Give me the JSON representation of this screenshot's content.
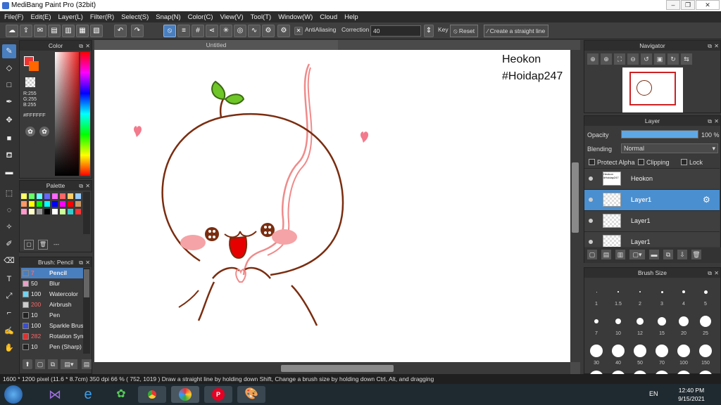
{
  "window": {
    "title": "MediBang Paint Pro (32bit)"
  },
  "menu": [
    "File(F)",
    "Edit(E)",
    "Layer(L)",
    "Filter(R)",
    "Select(S)",
    "Snap(N)",
    "Color(C)",
    "View(V)",
    "Tool(T)",
    "Window(W)",
    "Cloud",
    "Help"
  ],
  "toolbar": {
    "antialias_label": "AntiAliasing",
    "correction_label": "Correction",
    "correction_value": "40",
    "key_label": "Key",
    "reset_label": "Reset",
    "straight_label": "Create a straight line"
  },
  "color_panel": {
    "title": "Color",
    "r": "R:255",
    "g": "G:255",
    "b": "B:255",
    "hex": "#FFFFFF"
  },
  "palette_panel": {
    "title": "Palette",
    "extra": "---"
  },
  "brush_panel": {
    "title": "Brush: Pencil",
    "brushes": [
      {
        "size": "7",
        "name": "Pencil",
        "color": "#4a7fbf"
      },
      {
        "size": "50",
        "name": "Blur",
        "color": "#e8a0c8"
      },
      {
        "size": "100",
        "name": "Watercolor",
        "color": "#6fd3f0"
      },
      {
        "size": "200",
        "name": "Airbrush",
        "color": "#cccccc"
      },
      {
        "size": "10",
        "name": "Pen",
        "color": "#222222"
      },
      {
        "size": "100",
        "name": "Sparkle Brush",
        "color": "#3a4fd0"
      },
      {
        "size": "282",
        "name": "Rotation Symmetry",
        "color": "#e03030"
      },
      {
        "size": "10",
        "name": "Pen (Sharp)",
        "color": "#222222"
      }
    ]
  },
  "canvas": {
    "tab": "Untitled",
    "text_line1": "Heokon",
    "text_line2": "#Hoidap247"
  },
  "navigator": {
    "title": "Navigator"
  },
  "layer_panel": {
    "title": "Layer",
    "opacity_label": "Opacity",
    "opacity_value": "100 %",
    "opacity_level": 1.0,
    "blending_label": "Blending",
    "blending_value": "Normal",
    "protect_alpha": "Protect Alpha",
    "clipping": "Clipping",
    "lock": "Lock",
    "layers": [
      {
        "name": "Heokon",
        "thumb_text": "Heokon #Hoidap247"
      },
      {
        "name": "Layer1",
        "selected": true
      },
      {
        "name": "Layer1"
      },
      {
        "name": "Layer1"
      }
    ]
  },
  "brush_size_panel": {
    "title": "Brush Size",
    "sizes": [
      "1",
      "1.5",
      "2",
      "3",
      "4",
      "5",
      "7",
      "10",
      "12",
      "15",
      "20",
      "25",
      "30",
      "40",
      "50",
      "70",
      "100",
      "150"
    ]
  },
  "status": {
    "text": "1600 * 1200 pixel  (11.6 * 8.7cm)  350 dpi  66 %   ( 752, 1019 )  Draw a straight line by holding down Shift, Change a brush size by holding down Ctrl, Alt, and dragging"
  },
  "taskbar": {
    "lang": "EN",
    "time": "12:40 PM",
    "date": "9/15/2021"
  }
}
